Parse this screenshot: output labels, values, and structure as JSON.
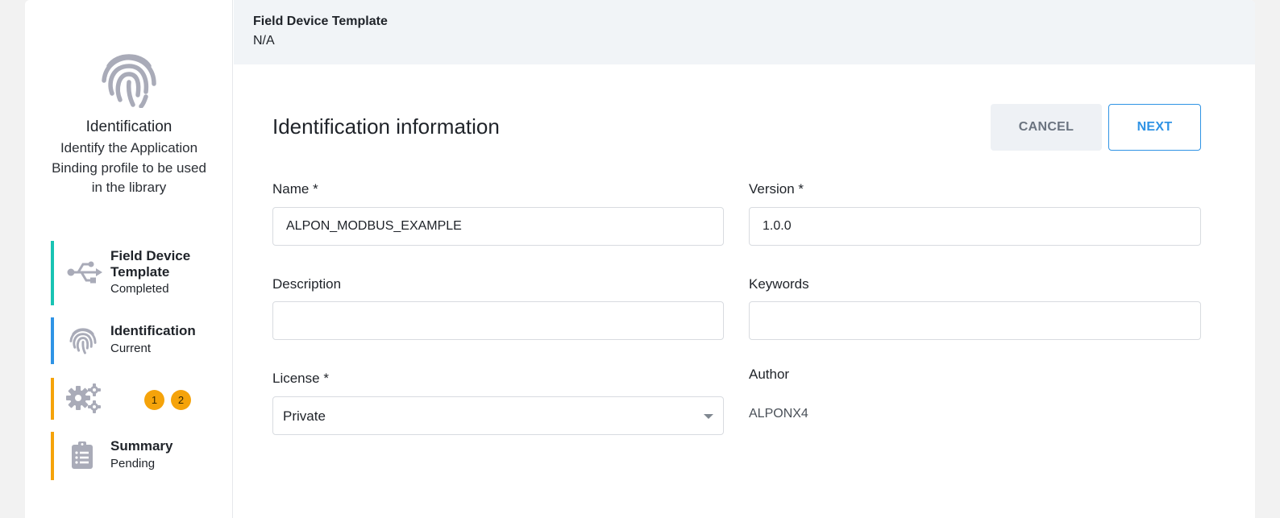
{
  "sidebar": {
    "hero": {
      "icon": "fingerprint-icon",
      "title": "Identification",
      "description": "Identify the Application Binding profile to be used in the library"
    },
    "steps": [
      {
        "icon": "usb-icon",
        "label_line1": "Field Device",
        "label_line2": "Template",
        "status": "Completed",
        "color": "#19c3b3"
      },
      {
        "icon": "fingerprint-icon",
        "label": "Identification",
        "status": "Current",
        "color": "#2f93e5"
      },
      {
        "icon": "gears-icon",
        "badges": [
          "1",
          "2"
        ],
        "color": "#f5a30a"
      },
      {
        "icon": "clipboard-icon",
        "label": "Summary",
        "status": "Pending",
        "color": "#f5a30a"
      }
    ]
  },
  "header": {
    "label": "Field Device Template",
    "value": "N/A"
  },
  "form": {
    "title": "Identification information",
    "cancel_label": "CANCEL",
    "next_label": "NEXT",
    "name": {
      "label": "Name *",
      "value": "ALPON_MODBUS_EXAMPLE"
    },
    "version": {
      "label": "Version *",
      "value": "1.0.0"
    },
    "description": {
      "label": "Description",
      "value": ""
    },
    "keywords": {
      "label": "Keywords",
      "value": ""
    },
    "license": {
      "label": "License *",
      "value": "Private"
    },
    "author": {
      "label": "Author",
      "value": "ALPONX4"
    }
  },
  "colors": {
    "accent_blue": "#2f93e5",
    "accent_teal": "#19c3b3",
    "accent_amber": "#f5a30a",
    "icon_gray": "#a9abb8"
  }
}
